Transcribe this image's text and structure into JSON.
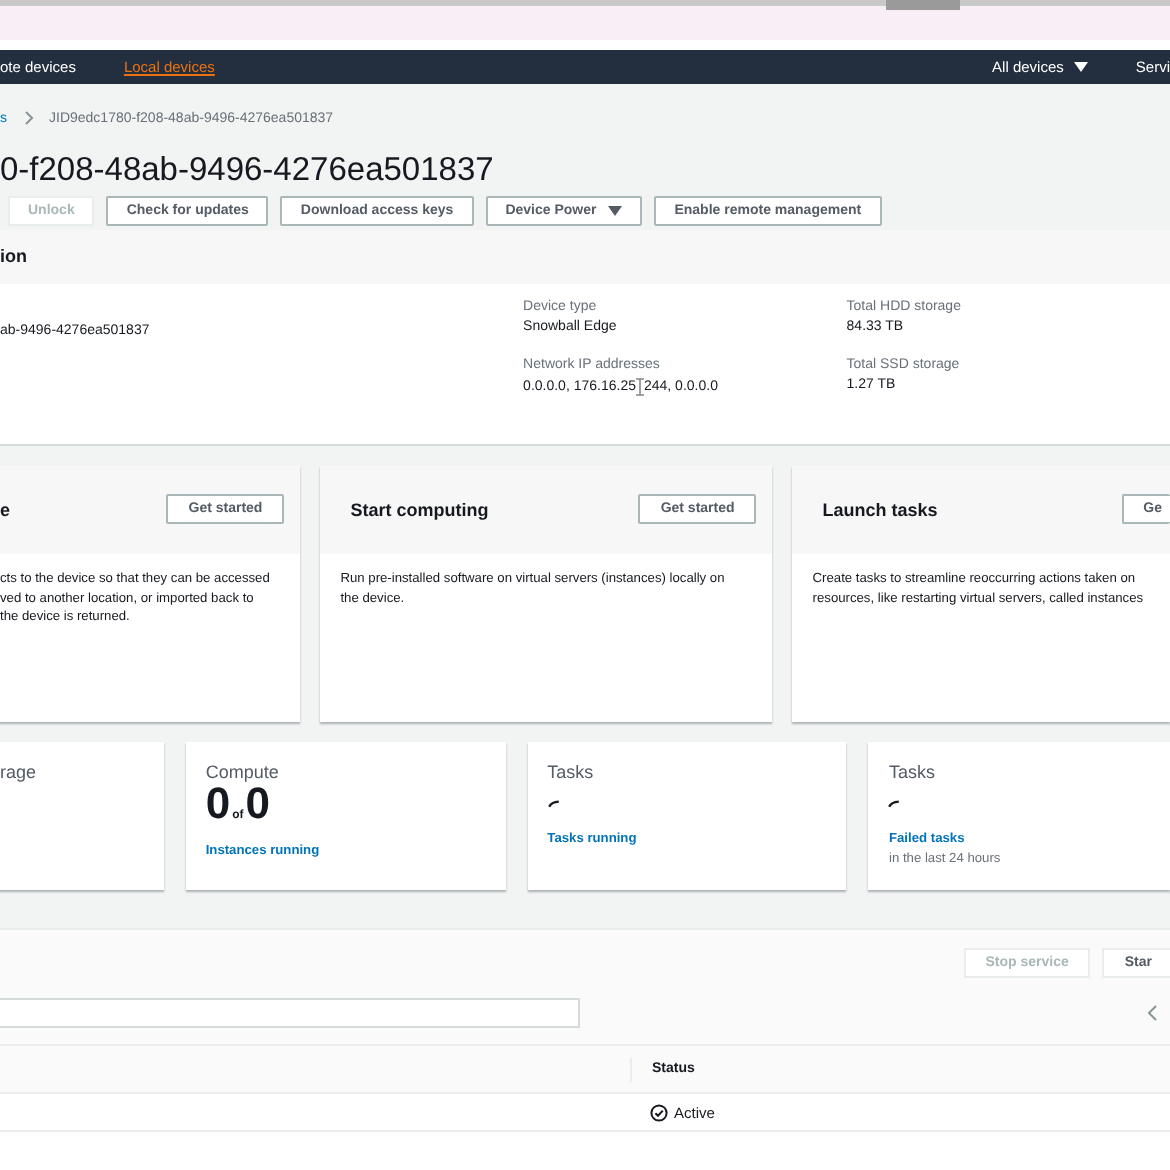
{
  "nav": {
    "items": [
      {
        "label": "ote devices",
        "selected": false
      },
      {
        "label": "Local devices",
        "selected": true
      }
    ],
    "right": [
      {
        "label": "All devices",
        "kind": "dropdown"
      },
      {
        "label": "Servi",
        "kind": "link"
      }
    ]
  },
  "breadcrumb": [
    {
      "label": "s",
      "kind": "link"
    },
    {
      "label": "JID9edc1780-f208-48ab-9496-4276ea501837",
      "kind": "current"
    }
  ],
  "title": "0-f208-48ab-9496-4276ea501837",
  "actions": [
    {
      "label": "Unlock",
      "kind": "button",
      "disabled": true
    },
    {
      "label": "Check for updates",
      "kind": "button",
      "disabled": false
    },
    {
      "label": "Download access keys",
      "kind": "button",
      "disabled": false
    },
    {
      "label": "Device Power",
      "kind": "dropdown",
      "disabled": false
    },
    {
      "label": "Enable remote management",
      "kind": "button",
      "disabled": false
    }
  ],
  "details": {
    "title": "ion",
    "id_value": "ab-9496-4276ea501837",
    "columns": [
      [
        {
          "label": "Device type",
          "value": "Snowball Edge"
        },
        {
          "label": "Network IP addresses",
          "value": "0.0.0.0, 176.16.25",
          "value_after": "244, 0.0.0.0"
        }
      ],
      [
        {
          "label": "Total HDD storage",
          "value": "84.33 TB"
        },
        {
          "label": "Total SSD storage",
          "value": "1.27 TB"
        }
      ]
    ]
  },
  "feature_cards": [
    {
      "title": "e",
      "button": "Get started",
      "body": "cts to the device so that they can be accessed\nved to another location, or imported back to\nthe device is returned."
    },
    {
      "title": "Start computing",
      "button": "Get started",
      "body": "Run pre-installed software on virtual servers (instances) locally on\nthe device."
    },
    {
      "title": "Launch tasks",
      "button": "Ge",
      "body": "Create tasks to streamline reoccurring actions taken on\nresources, like restarting virtual servers, called instances"
    }
  ],
  "metrics": [
    {
      "title": "rage",
      "kind": "empty"
    },
    {
      "title": "Compute",
      "kind": "count",
      "value": "0",
      "of": "of",
      "total": "0",
      "link": "Instances running"
    },
    {
      "title": "Tasks",
      "kind": "loading",
      "link": "Tasks running"
    },
    {
      "title": "Tasks",
      "kind": "loading",
      "link": "Failed tasks",
      "note": "in the last 24 hours"
    }
  ],
  "services": {
    "buttons": [
      {
        "label": "Stop service",
        "disabled": true
      },
      {
        "label": "Star",
        "disabled": false
      }
    ],
    "columns": [
      {
        "label": "Status"
      }
    ],
    "rows": [
      {
        "status": "Active"
      }
    ]
  }
}
